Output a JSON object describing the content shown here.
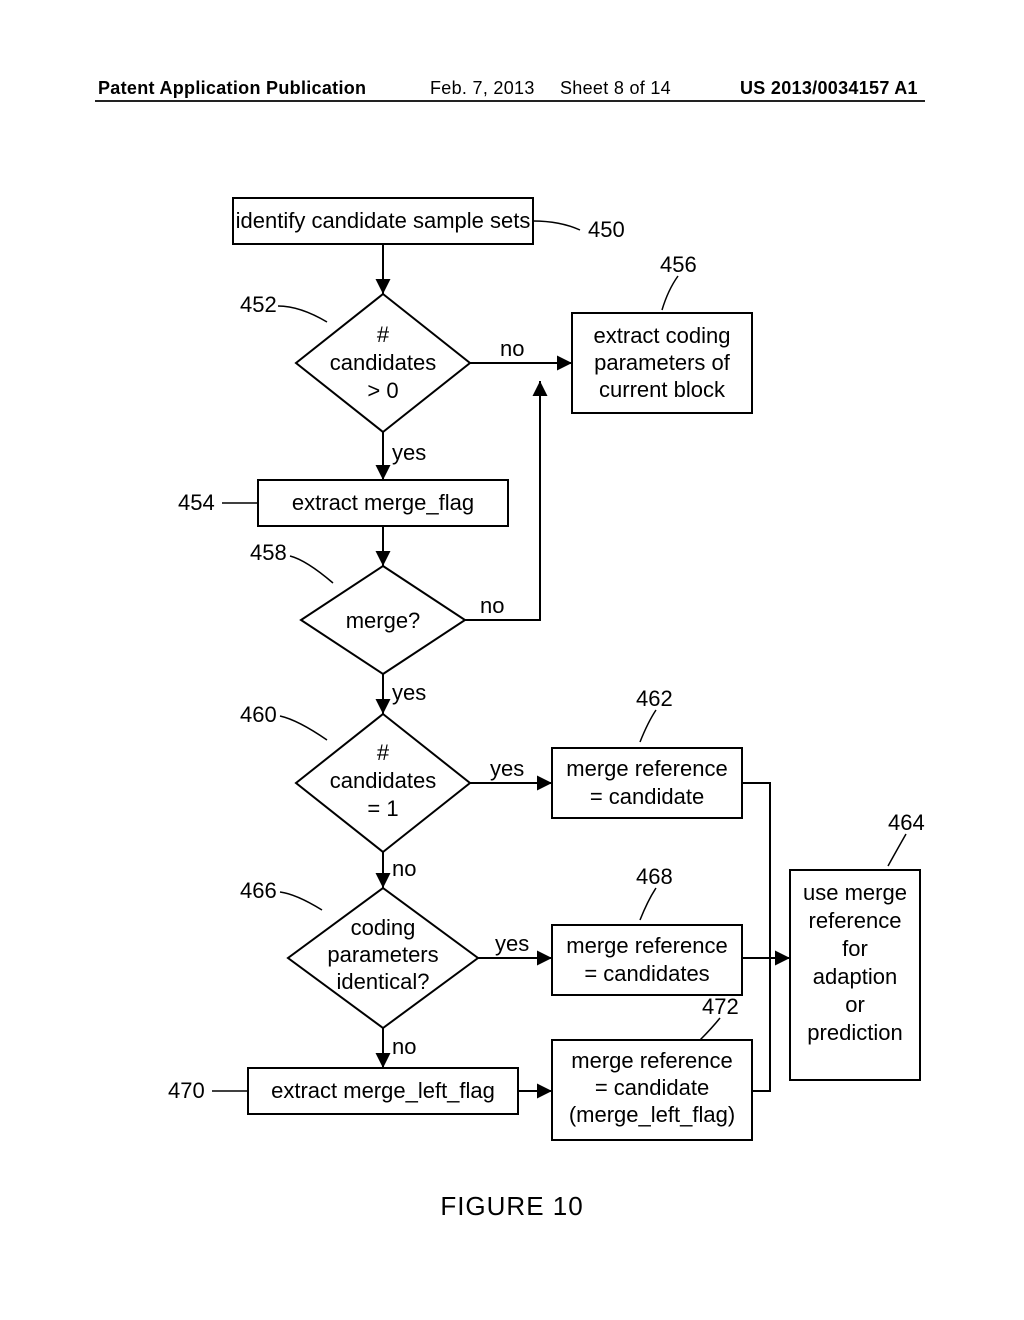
{
  "header": {
    "left": "Patent Application Publication",
    "date": "Feb. 7, 2013",
    "sheet": "Sheet 8 of 14",
    "pubno": "US 2013/0034157 A1"
  },
  "refs": {
    "r450": "450",
    "r452": "452",
    "r454": "454",
    "r456": "456",
    "r458": "458",
    "r460": "460",
    "r462": "462",
    "r464": "464",
    "r466": "466",
    "r468": "468",
    "r470": "470",
    "r472": "472"
  },
  "boxes": {
    "b450": "identify candidate sample sets",
    "b454": "extract merge_flag",
    "b456_l1": "extract coding",
    "b456_l2": "parameters of",
    "b456_l3": "current block",
    "b462_l1": "merge reference",
    "b462_l2": "= candidate",
    "b468_l1": "merge reference",
    "b468_l2": "= candidates",
    "b470": "extract merge_left_flag",
    "b472_l1": "merge reference",
    "b472_l2": "= candidate",
    "b472_l3": "(merge_left_flag)",
    "b464_l1": "use merge",
    "b464_l2": "reference",
    "b464_l3": "for",
    "b464_l4": "adaption",
    "b464_l5": "or",
    "b464_l6": "prediction"
  },
  "diamonds": {
    "d452_l1": "#",
    "d452_l2": "candidates",
    "d452_l3": "> 0",
    "d458": "merge?",
    "d460_l1": "#",
    "d460_l2": "candidates",
    "d460_l3": "= 1",
    "d466_l1": "coding",
    "d466_l2": "parameters",
    "d466_l3": "identical?"
  },
  "edges": {
    "yes": "yes",
    "no": "no"
  },
  "figure": "FIGURE 10"
}
